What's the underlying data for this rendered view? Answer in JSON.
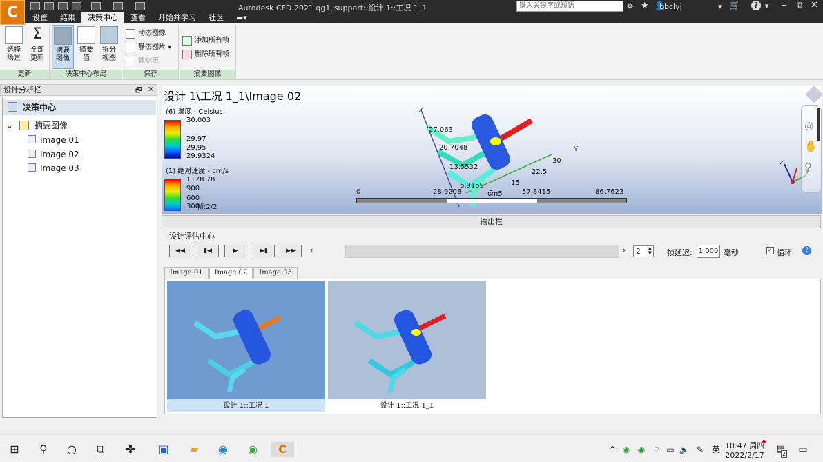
{
  "titlebar": {
    "app_title": "Autodesk CFD 2021    qg1_support::设计 1::工况 1_1",
    "search_placeholder": "键入关键字或短语",
    "user": "bbclyj",
    "help": "?"
  },
  "menu_tabs": [
    "设置",
    "结果",
    "决策中心",
    "查看",
    "开始并学习",
    "社区"
  ],
  "ribbon": {
    "groups": [
      {
        "label": "更新"
      },
      {
        "label": "决策中心布局"
      },
      {
        "label": "保存"
      },
      {
        "label": "摘要图像"
      }
    ],
    "buttons": {
      "select_scene": "选择\n场景",
      "update_all": "全部\n更新",
      "summary_image": "摘要\n图像",
      "summary_value": "摘要\n值",
      "split_view": "拆分\n视图",
      "dynamic_image": "动态图像",
      "static_image": "静态图片",
      "data_table": "数据表",
      "add_all_frames": "添加所有帧",
      "delete_all_frames": "删除所有帧"
    }
  },
  "left_panel": {
    "title": "设计分析栏",
    "root": "决策中心",
    "group": "摘要图像",
    "items": [
      "Image 01",
      "Image 02",
      "Image 03"
    ]
  },
  "viewport": {
    "title": "设计 1\\工况 1_1\\Image 02",
    "legend_temp": {
      "title": "(6) 温度 - Celsius",
      "ticks": [
        "30.003",
        "29.97",
        "29.95",
        "29.9324"
      ]
    },
    "legend_vel": {
      "title": "(1) 绝对速度 - cm/s",
      "ticks": [
        "1178.78",
        "900",
        "600",
        "300"
      ]
    },
    "frame": "帧:2/2",
    "scale": {
      "ticks": [
        "0",
        "28.9208",
        "57.8415",
        "86.7623"
      ],
      "unit": "cm"
    },
    "axis_labels": {
      "z": "Z",
      "y": "Y",
      "x": "X"
    },
    "probe_values": [
      "27.063",
      "20.7048",
      "13.5532",
      "6.9159",
      "5",
      "15",
      "22.5",
      "30"
    ],
    "probe_mid": "cm5"
  },
  "output_bar": "输出栏",
  "decision_center": {
    "label": "设计评估中心",
    "frame_input": "2",
    "delay_label": "帧延迟:",
    "delay_value": "1,000",
    "delay_unit": "毫秒",
    "loop_label": "循环",
    "loop_checked": true
  },
  "image_tabs": [
    "Image 01",
    "Image 02",
    "Image 03"
  ],
  "thumbnails": [
    {
      "caption": "设计 1::工况 1"
    },
    {
      "caption": "设计 1::工况 1_1"
    }
  ],
  "taskbar": {
    "time": "10:47 周四",
    "date": "2022/2/17",
    "ime": "英",
    "notif": "2"
  },
  "colors": {
    "accent": "#e07a10",
    "ribbon_group": "#cfe6cf",
    "selection": "#c9dcf2"
  }
}
